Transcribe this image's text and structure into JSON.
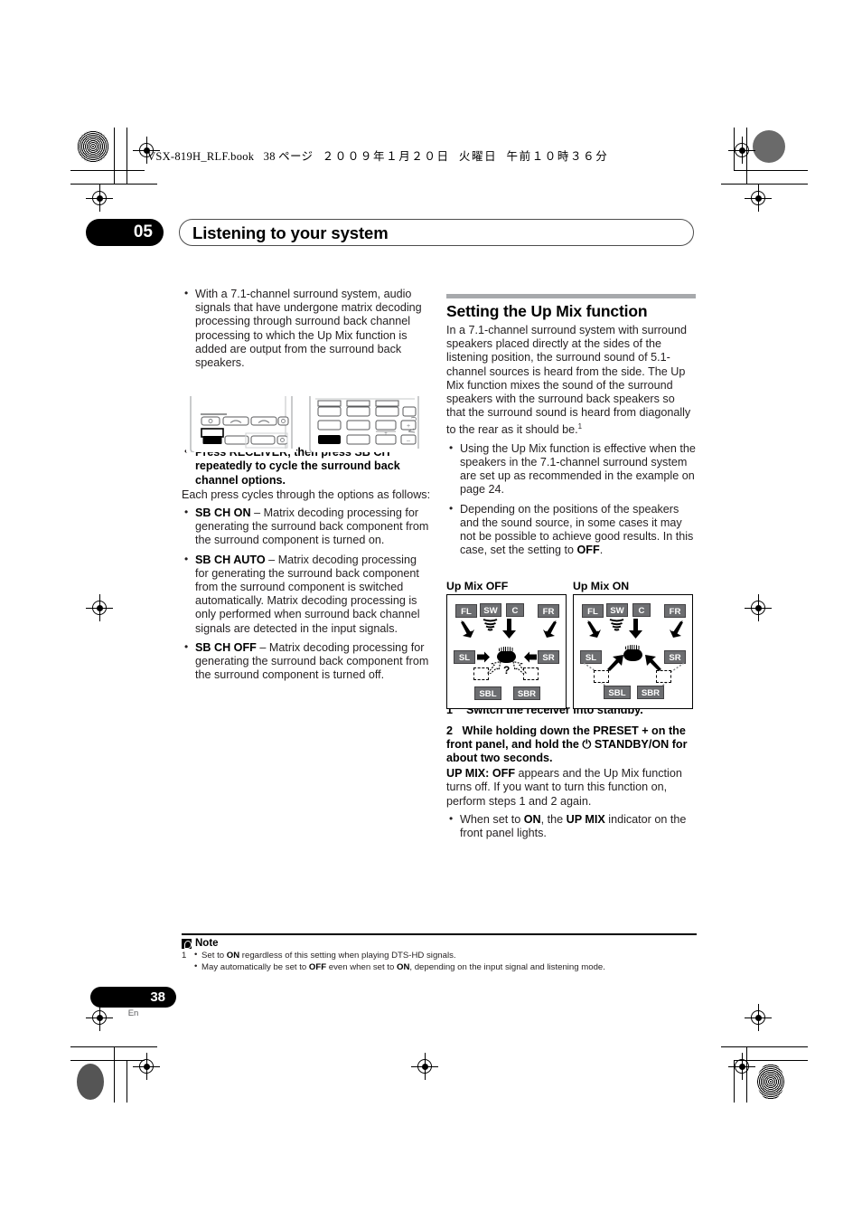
{
  "print_header": {
    "filename": "VSX-819H_RLF.book",
    "page_marker": "38 ページ",
    "date": "２００９年１月２０日",
    "weekday": "火曜日",
    "time": "午前１０時３６分"
  },
  "chapter": {
    "number": "05",
    "title": "Listening to your system"
  },
  "left_column": {
    "intro_bullet": "With a 7.1-channel surround system, audio signals that have undergone matrix decoding processing through surround back channel processing to which the Up Mix function is added are output from the surround back speakers.",
    "remote_images": {
      "left_remote_name": "receiver-remote-top-buttons",
      "right_remote_name": "remote-keypad-sb-ch-button"
    },
    "instruction_bold": "Press RECEIVER, then press SB CH repeatedly to cycle the surround back channel options.",
    "instruction_follow": "Each press cycles through the options as follows:",
    "options": [
      {
        "term": "SB CH ON",
        "dash": " – ",
        "desc": "Matrix decoding processing for generating the surround back component from the surround component is turned on."
      },
      {
        "term": "SB CH AUTO",
        "dash": " – ",
        "desc": "Matrix decoding processing for generating the surround back component from the surround component is switched automatically. Matrix decoding processing is only performed when surround back channel signals are detected in the input signals."
      },
      {
        "term": "SB CH OFF",
        "dash": " – ",
        "desc": "Matrix decoding processing for generating the surround back component from the surround component is turned off."
      }
    ]
  },
  "right_column": {
    "section_title": "Setting the Up Mix function",
    "body_part1": "In a 7.1-channel surround system with surround speakers placed directly at the sides of the listening position, the surround sound of 5.1-channel sources is heard from the side. The Up Mix function mixes the sound of the surround speakers with the surround back speakers so that the surround sound is heard from diagonally to the rear as it should be.",
    "body_footnote_marker": "1",
    "bullets": [
      {
        "text_1": "Using the Up Mix function is effective when the speakers in the 7.1-channel surround system are set up as recommended in the example on page 24.",
        "bold": "",
        "text_2": ""
      },
      {
        "text_1": "Depending on the positions of the speakers and the sound source, in some cases it may not be possible to achieve good results. In this case, set the setting to ",
        "bold": "OFF",
        "text_2": "."
      }
    ],
    "diagrams": {
      "left_label": "Up Mix OFF",
      "right_label": "Up Mix ON",
      "speakers": {
        "fl": "FL",
        "sw": "SW",
        "c": "C",
        "fr": "FR",
        "sl": "SL",
        "sr": "SR",
        "sbl": "SBL",
        "sbr": "SBR"
      },
      "question_mark": "?"
    },
    "steps": [
      {
        "number": "1",
        "text": "Switch the receiver into standby."
      },
      {
        "number": "2",
        "text_before": "While holding down the PRESET + on the front panel, and hold the ",
        "power_glyph": "⏻",
        "text_after": " STANDBY/ON for about two seconds."
      }
    ],
    "step2_result_bold": "UP MIX: OFF",
    "step2_result_rest": " appears and the Up Mix function turns off. If you want to turn this function on, perform steps 1 and 2 again.",
    "step2_bullet": {
      "t1": "When set to ",
      "b1": "ON",
      "t2": ", the ",
      "b2": "UP MIX",
      "t3": " indicator on the front panel lights."
    }
  },
  "note": {
    "heading": "Note",
    "footnote_number": "1",
    "items": [
      {
        "t1": "Set to ",
        "b1": "ON",
        "t2": " regardless of this setting when playing DTS-HD signals.",
        "b2": "",
        "t3": ""
      },
      {
        "t1": "May automatically be set to ",
        "b1": "OFF",
        "t2": " even when set to ",
        "b2": "ON",
        "t3": ", depending on the input signal and listening mode."
      }
    ]
  },
  "footer": {
    "page_number": "38",
    "language": "En"
  },
  "colors": {
    "speaker_fill": "#6d6e71",
    "section_bar": "#a7a9ac",
    "text": "#231f20",
    "accent_black": "#000000"
  }
}
